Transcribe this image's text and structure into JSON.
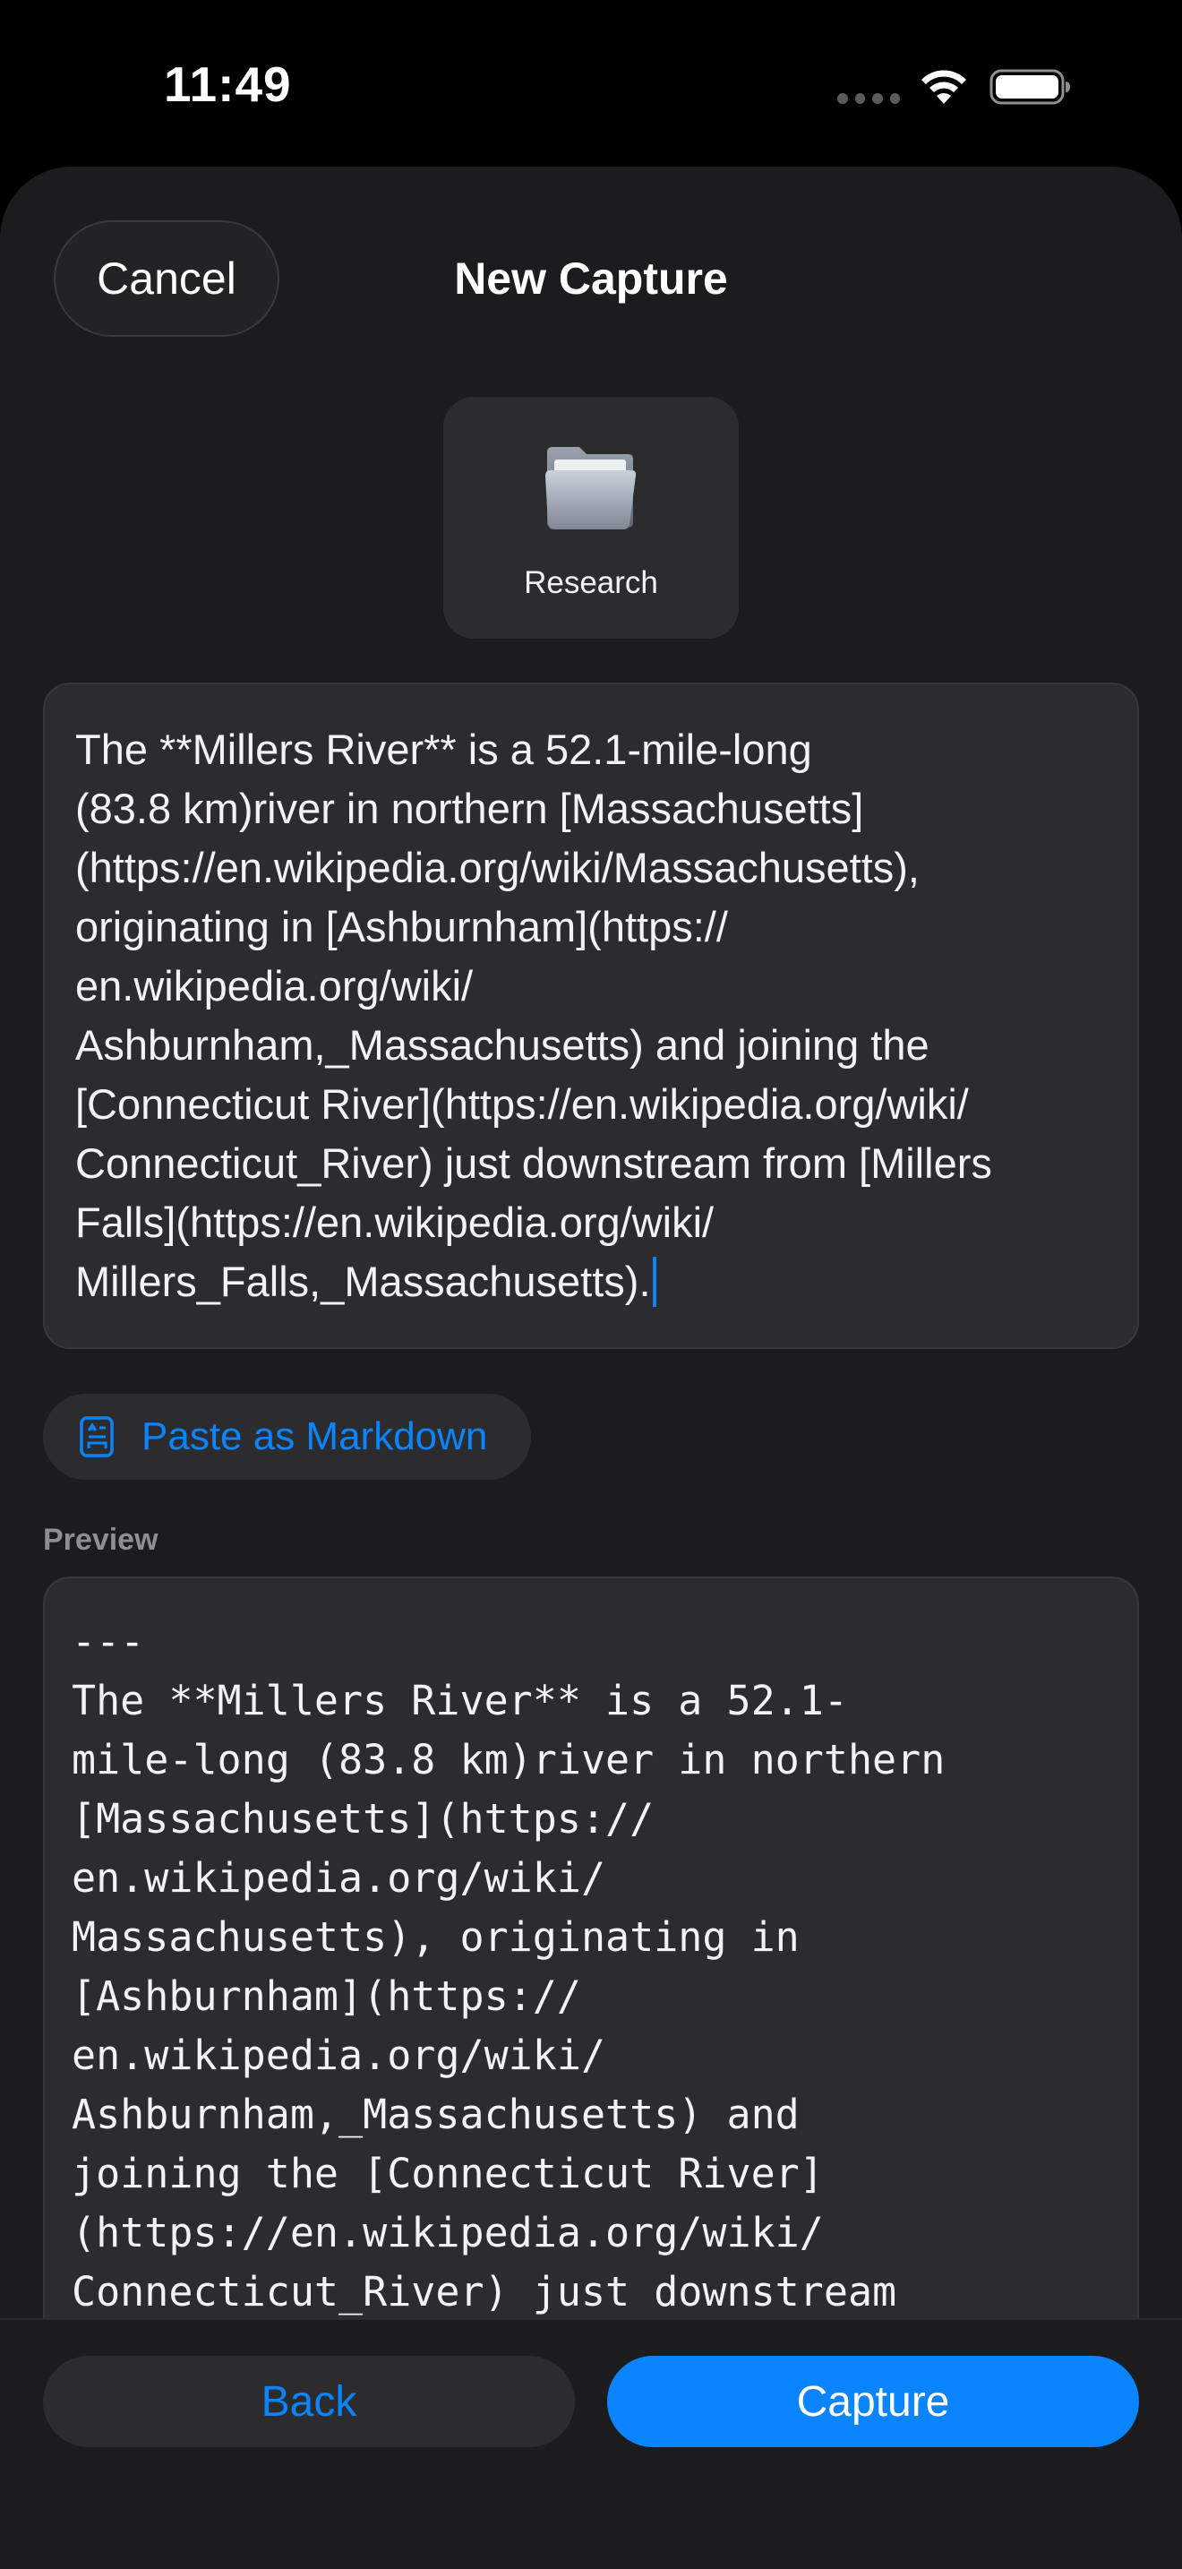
{
  "status_bar": {
    "time": "11:49",
    "icons": [
      "signal-dots-icon",
      "wifi-icon",
      "battery-icon"
    ]
  },
  "header": {
    "cancel_label": "Cancel",
    "title": "New Capture"
  },
  "folder": {
    "icon": "folder-icon",
    "label": "Research"
  },
  "editor": {
    "text": "The **Millers River** is a 52.1-mile-long\n(83.8 km)river in northern [Massachusetts]\n(https://en.wikipedia.org/wiki/Massachusetts),\noriginating in [Ashburnham](https://\nen.wikipedia.org/wiki/\nAshburnham,_Massachusetts) and joining the\n[Connecticut River](https://en.wikipedia.org/wiki/\nConnecticut_River) just downstream from [Millers\nFalls](https://en.wikipedia.org/wiki/\nMillers_Falls,_Massachusetts)."
  },
  "paste_button": {
    "icon": "markdown-document-icon",
    "label": "Paste as Markdown"
  },
  "preview": {
    "label": "Preview",
    "text": "---\nThe **Millers River** is a 52.1-\nmile-long (83.8 km)river in northern\n[Massachusetts](https://\nen.wikipedia.org/wiki/\nMassachusetts), originating in\n[Ashburnham](https://\nen.wikipedia.org/wiki/\nAshburnham,_Massachusetts) and\njoining the [Connecticut River]\n(https://en.wikipedia.org/wiki/\nConnecticut_River) just downstream"
  },
  "footer": {
    "back_label": "Back",
    "capture_label": "Capture"
  },
  "colors": {
    "accent": "#0a84ff",
    "sheet_background": "#1c1c1e",
    "field_background": "#2c2c2e"
  }
}
